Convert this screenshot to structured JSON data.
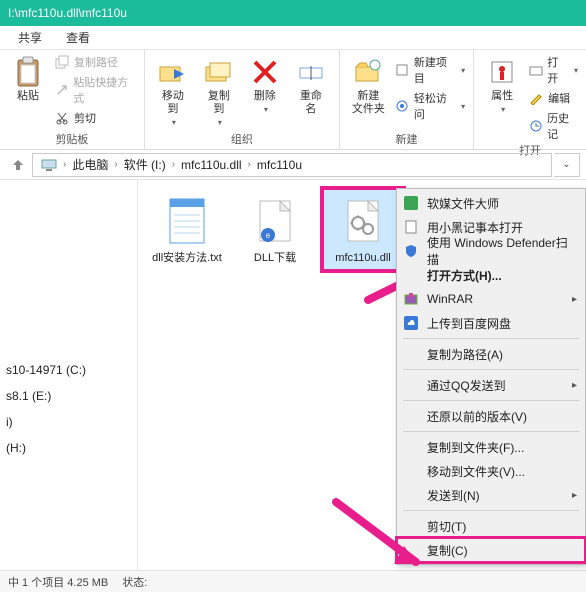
{
  "titlebar": {
    "path": "I:\\mfc110u.dll\\mfc110u"
  },
  "tabs": {
    "share": "共享",
    "view": "查看"
  },
  "ribbon": {
    "clipboard": {
      "label": "剪贴板",
      "paste": "粘贴",
      "copypath": "复制路径",
      "pasteshort": "粘贴快捷方式",
      "cut": "剪切"
    },
    "organize": {
      "label": "组织",
      "moveto": "移动到",
      "copyto": "复制到",
      "delete": "删除",
      "rename": "重命名"
    },
    "new": {
      "label": "新建",
      "newfolder": "新建\n文件夹",
      "newitem": "新建项目",
      "easyaccess": "轻松访问"
    },
    "open": {
      "label": "打开",
      "properties": "属性",
      "open": "打开",
      "edit": "编辑",
      "history": "历史记"
    }
  },
  "breadcrumb": {
    "thispc": "此电脑",
    "drive": "软件 (I:)",
    "folder1": "mfc110u.dll",
    "folder2": "mfc110u"
  },
  "sidebar": {
    "i0": "s10-14971 (C:)",
    "i1": "",
    "i2": "s8.1 (E:)",
    "i3": "",
    "i4": "i)",
    "i5": "",
    "i6": "(H:)"
  },
  "files": {
    "f0": "dll安装方法.txt",
    "f1": "DLL下载",
    "f2": "mfc110u.dll"
  },
  "ctx": {
    "c0": "软媒文件大师",
    "c1": "用小黑记事本打开",
    "c2": "使用 Windows Defender扫描",
    "c3": "打开方式(H)...",
    "c4": "WinRAR",
    "c5": "上传到百度网盘",
    "c6": "复制为路径(A)",
    "c7": "通过QQ发送到",
    "c8": "还原以前的版本(V)",
    "c9": "复制到文件夹(F)...",
    "c10": "移动到文件夹(V)...",
    "c11": "发送到(N)",
    "c12": "剪切(T)",
    "c13": "复制(C)"
  },
  "status": {
    "left": "中 1 个项目  4.25 MB",
    "right": "状态:"
  }
}
